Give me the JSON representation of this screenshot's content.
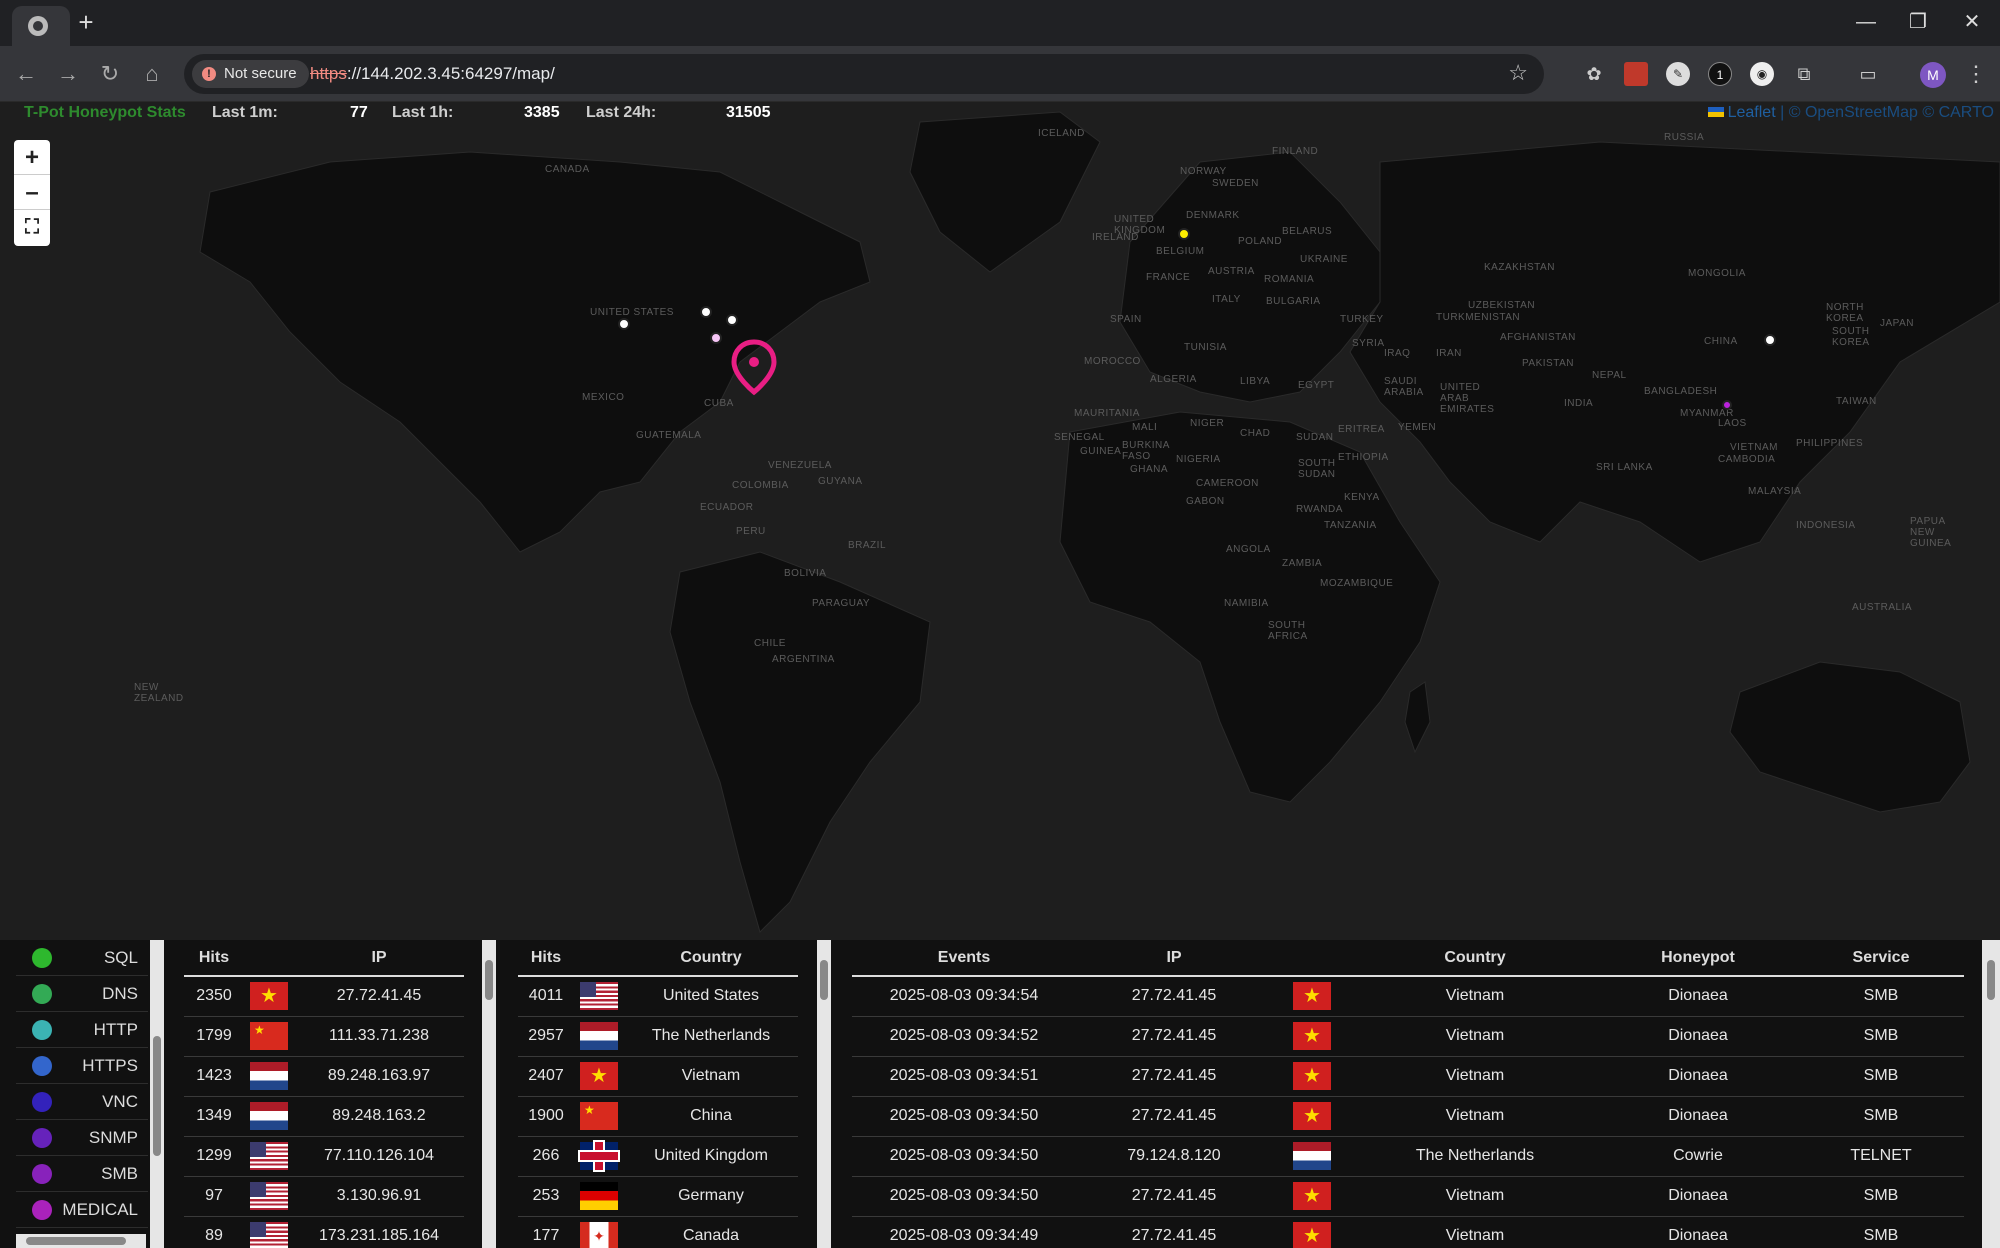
{
  "browser": {
    "security_label": "Not secure",
    "url_scheme": "https",
    "url_rest": "://144.202.3.45:64297/map/",
    "profile_initial": "M"
  },
  "stats": {
    "brand": "T-Pot Honeypot Stats",
    "last_1m_label": "Last 1m:",
    "last_1m": "77",
    "last_1h_label": "Last 1h:",
    "last_1h": "3385",
    "last_24h_label": "Last 24h:",
    "last_24h": "31505"
  },
  "map": {
    "attribution_leaflet": "Leaflet",
    "attribution_rest": " | © OpenStreetMap © CARTO",
    "zoom_in": "+",
    "zoom_out": "–",
    "fullscreen": "⛶",
    "labels": [
      "CANADA",
      "UNITED STATES",
      "MEXICO",
      "CUBA",
      "GUATEMALA",
      "VENEZUELA",
      "COLOMBIA",
      "GUYANA",
      "ECUADOR",
      "PERU",
      "BRAZIL",
      "BOLIVIA",
      "PARAGUAY",
      "CHILE",
      "ARGENTINA",
      "ICELAND",
      "NORWAY",
      "SWEDEN",
      "FINLAND",
      "UNITED KINGDOM",
      "IRELAND",
      "DENMARK",
      "BELARUS",
      "POLAND",
      "UKRAINE",
      "FRANCE",
      "AUSTRIA",
      "ROMANIA",
      "BULGARIA",
      "SPAIN",
      "ITALY",
      "TURKEY",
      "TUNISIA",
      "MOROCCO",
      "ALGERIA",
      "LIBYA",
      "EGYPT",
      "SYRIA",
      "IRAQ",
      "IRAN",
      "SAUDI ARABIA",
      "UNITED ARAB EMIRATES",
      "YEMEN",
      "ERITREA",
      "SUDAN",
      "CHAD",
      "NIGER",
      "MALI",
      "MAURITANIA",
      "SENEGAL",
      "GUINEA",
      "BURKINA FASO",
      "GHANA",
      "NIGERIA",
      "CAMEROON",
      "GABON",
      "SOUTH SUDAN",
      "ETHIOPIA",
      "KENYA",
      "TANZANIA",
      "RWANDA",
      "ANGOLA",
      "ZAMBIA",
      "NAMIBIA",
      "MOZAMBIQUE",
      "SOUTH AFRICA",
      "RUSSIA",
      "KAZAKHSTAN",
      "UZBEKISTAN",
      "TURKMENISTAN",
      "AFGHANISTAN",
      "PAKISTAN",
      "INDIA",
      "NEPAL",
      "BANGLADESH",
      "MONGOLIA",
      "CHINA",
      "NORTH KOREA",
      "SOUTH KOREA",
      "MYANMAR",
      "LAOS",
      "VIETNAM",
      "CAMBODIA",
      "PHILIPPINES",
      "MALAYSIA",
      "INDONESIA",
      "PAPUA NEW GUINEA",
      "AUSTRALIA",
      "NEW ZEALAND",
      "SRI LANKA",
      "TAIWAN",
      "JAPAN",
      "BELGIUM"
    ]
  },
  "legend": [
    {
      "name": "SQL",
      "color": "#2eb82e"
    },
    {
      "name": "DNS",
      "color": "#33aa55"
    },
    {
      "name": "HTTP",
      "color": "#3bb3b3"
    },
    {
      "name": "HTTPS",
      "color": "#3366cc"
    },
    {
      "name": "VNC",
      "color": "#3322bb"
    },
    {
      "name": "SNMP",
      "color": "#6622bb"
    },
    {
      "name": "SMB",
      "color": "#8822bb"
    },
    {
      "name": "MEDICAL",
      "color": "#aa22bb"
    }
  ],
  "ip_table": {
    "headers": [
      "Hits",
      "IP"
    ],
    "rows": [
      {
        "hits": "2350",
        "flag": "vn",
        "ip": "27.72.41.45"
      },
      {
        "hits": "1799",
        "flag": "cn",
        "ip": "111.33.71.238"
      },
      {
        "hits": "1423",
        "flag": "nl",
        "ip": "89.248.163.97"
      },
      {
        "hits": "1349",
        "flag": "nl",
        "ip": "89.248.163.2"
      },
      {
        "hits": "1299",
        "flag": "us",
        "ip": "77.110.126.104"
      },
      {
        "hits": "97",
        "flag": "us",
        "ip": "3.130.96.91"
      },
      {
        "hits": "89",
        "flag": "us",
        "ip": "173.231.185.164"
      }
    ]
  },
  "country_table": {
    "headers": [
      "Hits",
      "Country"
    ],
    "rows": [
      {
        "hits": "4011",
        "flag": "us",
        "country": "United States"
      },
      {
        "hits": "2957",
        "flag": "nl",
        "country": "The Netherlands"
      },
      {
        "hits": "2407",
        "flag": "vn",
        "country": "Vietnam"
      },
      {
        "hits": "1900",
        "flag": "cn",
        "country": "China"
      },
      {
        "hits": "266",
        "flag": "gb",
        "country": "United Kingdom"
      },
      {
        "hits": "253",
        "flag": "de",
        "country": "Germany"
      },
      {
        "hits": "177",
        "flag": "ca",
        "country": "Canada"
      }
    ]
  },
  "events_table": {
    "headers": [
      "Events",
      "IP",
      "",
      "Country",
      "Honeypot",
      "Service"
    ],
    "rows": [
      {
        "time": "2025-08-03 09:34:54",
        "ip": "27.72.41.45",
        "flag": "vn",
        "country": "Vietnam",
        "honeypot": "Dionaea",
        "service": "SMB"
      },
      {
        "time": "2025-08-03 09:34:52",
        "ip": "27.72.41.45",
        "flag": "vn",
        "country": "Vietnam",
        "honeypot": "Dionaea",
        "service": "SMB"
      },
      {
        "time": "2025-08-03 09:34:51",
        "ip": "27.72.41.45",
        "flag": "vn",
        "country": "Vietnam",
        "honeypot": "Dionaea",
        "service": "SMB"
      },
      {
        "time": "2025-08-03 09:34:50",
        "ip": "27.72.41.45",
        "flag": "vn",
        "country": "Vietnam",
        "honeypot": "Dionaea",
        "service": "SMB"
      },
      {
        "time": "2025-08-03 09:34:50",
        "ip": "79.124.8.120",
        "flag": "nl",
        "country": "The Netherlands",
        "honeypot": "Cowrie",
        "service": "TELNET"
      },
      {
        "time": "2025-08-03 09:34:50",
        "ip": "27.72.41.45",
        "flag": "vn",
        "country": "Vietnam",
        "honeypot": "Dionaea",
        "service": "SMB"
      },
      {
        "time": "2025-08-03 09:34:49",
        "ip": "27.72.41.45",
        "flag": "vn",
        "country": "Vietnam",
        "honeypot": "Dionaea",
        "service": "SMB"
      }
    ]
  }
}
